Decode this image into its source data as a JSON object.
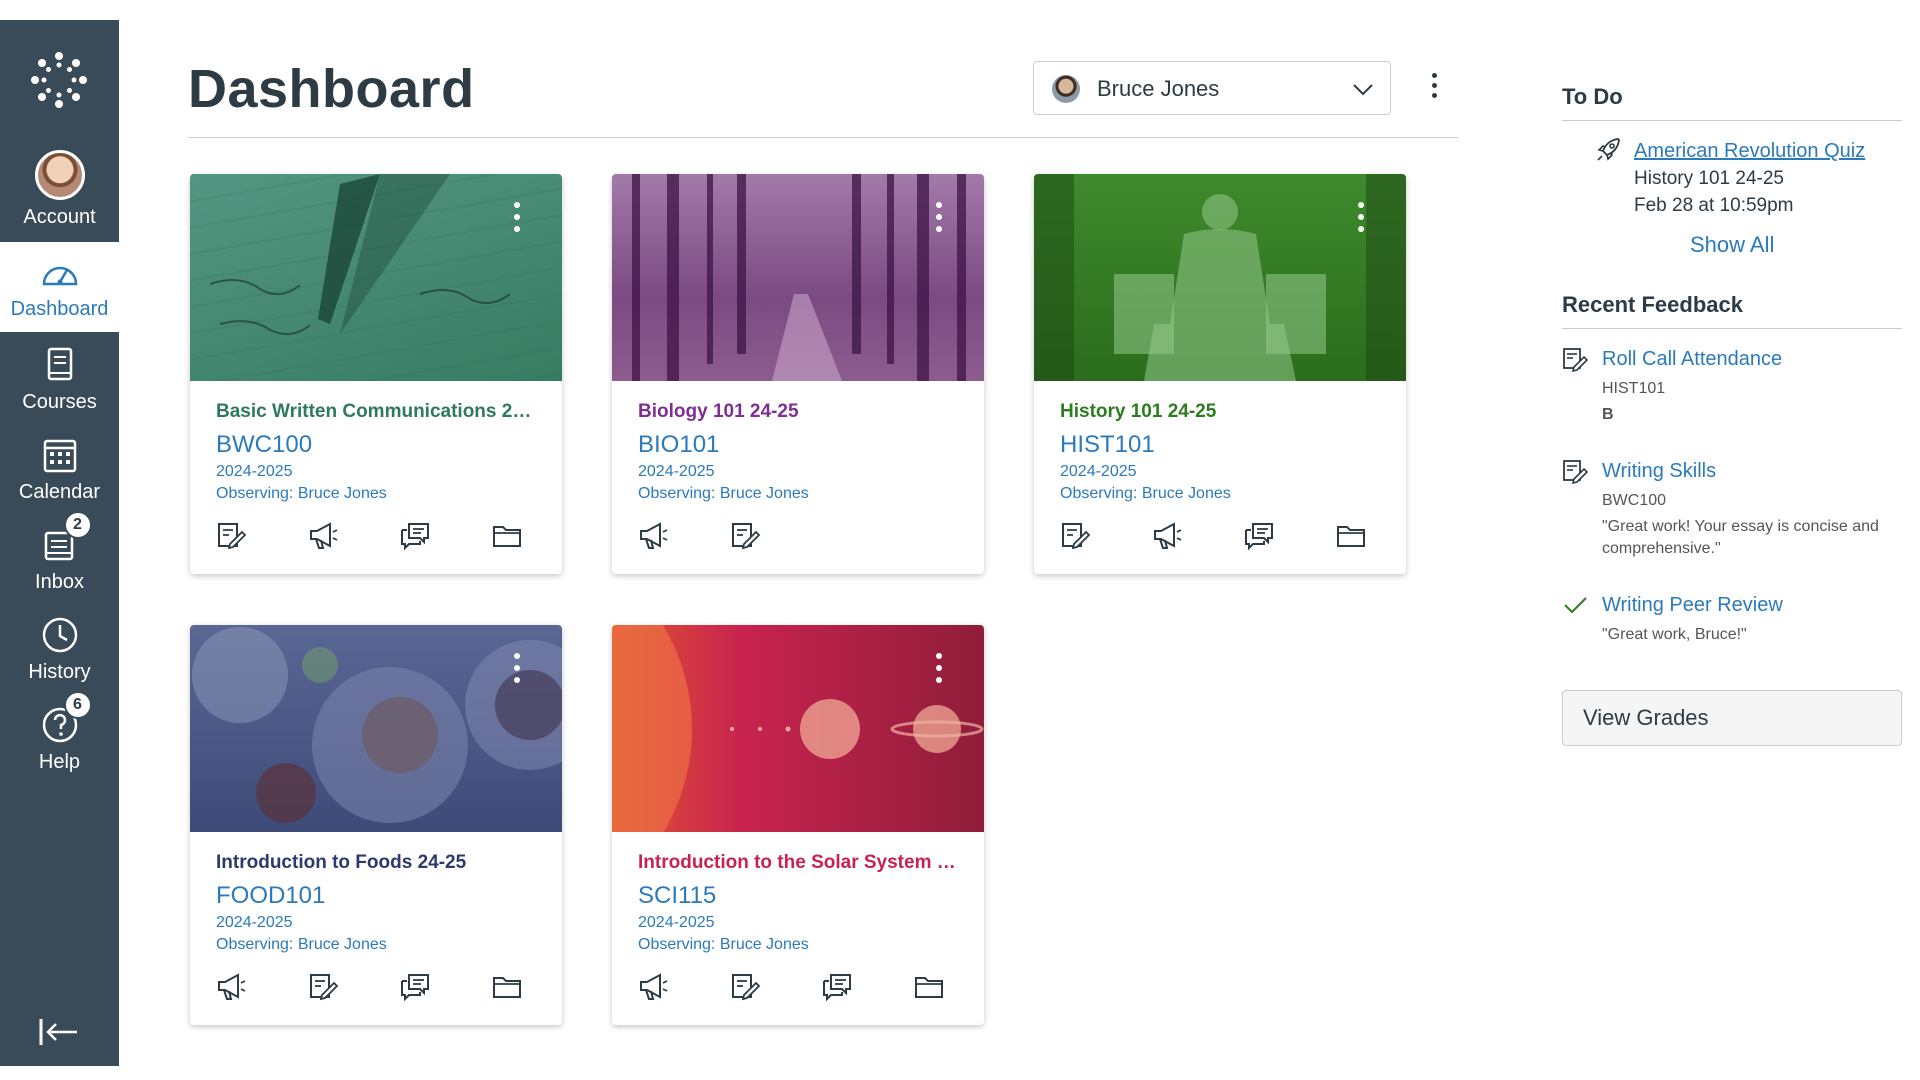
{
  "nav": {
    "logo": "canvas-logo-icon",
    "items": [
      {
        "label": "Account",
        "icon": "avatar"
      },
      {
        "label": "Dashboard",
        "icon": "dashboard-icon"
      },
      {
        "label": "Courses",
        "icon": "courses-icon"
      },
      {
        "label": "Calendar",
        "icon": "calendar-icon"
      },
      {
        "label": "Inbox",
        "icon": "inbox-icon",
        "badge": "2"
      },
      {
        "label": "History",
        "icon": "history-icon"
      },
      {
        "label": "Help",
        "icon": "help-icon",
        "badge": "6"
      }
    ]
  },
  "header": {
    "title": "Dashboard",
    "observer": "Bruce Jones"
  },
  "colors": {
    "nav_bg": "#394b58",
    "link": "#2b7abc",
    "card1": "#3f8a6e",
    "card2": "#8a3d9a",
    "card3": "#2f7d1f",
    "card4": "#2e3f7a",
    "card5": "#c8234f"
  },
  "cards": [
    {
      "title": "Basic Written Communications 24...",
      "code": "BWC100",
      "term": "2024-2025",
      "observing": "Observing: Bruce Jones",
      "title_color": "#2f7a5e"
    },
    {
      "title": "Biology 101 24-25",
      "code": "BIO101",
      "term": "2024-2025",
      "observing": "Observing: Bruce Jones",
      "title_color": "#7d2f93"
    },
    {
      "title": "History 101 24-25",
      "code": "HIST101",
      "term": "2024-2025",
      "observing": "Observing: Bruce Jones",
      "title_color": "#2c7d1e"
    },
    {
      "title": "Introduction to Foods 24-25",
      "code": "FOOD101",
      "term": "2024-2025",
      "observing": "Observing: Bruce Jones",
      "title_color": "#2e3a6e"
    },
    {
      "title": "Introduction to the Solar System 2...",
      "code": "SCI115",
      "term": "2024-2025",
      "observing": "Observing: Bruce Jones",
      "title_color": "#c8234f"
    }
  ],
  "todo": {
    "heading": "To Do",
    "item_title": "American Revolution Quiz",
    "item_course": "History 101 24-25",
    "item_due": "Feb 28 at 10:59pm",
    "show_all": "Show All"
  },
  "feedback": {
    "heading": "Recent Feedback",
    "items": [
      {
        "title": "Roll Call Attendance",
        "course": "HIST101",
        "grade": "B"
      },
      {
        "title": "Writing Skills",
        "course": "BWC100",
        "comment": "\"Great work! Your essay is concise and comprehensive.\""
      },
      {
        "title": "Writing Peer Review",
        "comment": "\"Great work, Bruce!\""
      }
    ]
  },
  "view_grades": "View Grades"
}
